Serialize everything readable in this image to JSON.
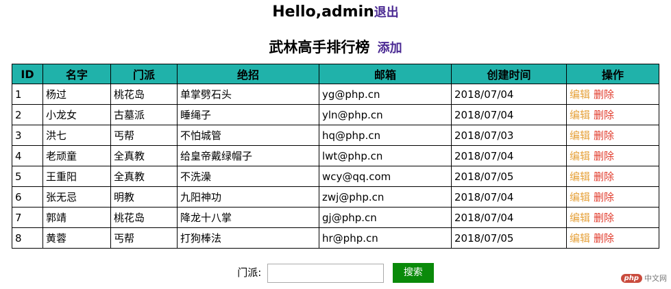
{
  "header": {
    "greeting": "Hello,admin",
    "logout": "退出"
  },
  "page": {
    "title": "武林高手排行榜",
    "add": "添加"
  },
  "table": {
    "columns": [
      "ID",
      "名字",
      "门派",
      "绝招",
      "邮箱",
      "创建时间",
      "操作"
    ],
    "rows": [
      {
        "id": "1",
        "name": "杨过",
        "sect": "桃花岛",
        "skill": "单掌劈石头",
        "email": "yg@php.cn",
        "created": "2018/07/04",
        "edit": "编辑",
        "delete": "删除"
      },
      {
        "id": "2",
        "name": "小龙女",
        "sect": "古墓派",
        "skill": "睡绳子",
        "email": "yln@php.cn",
        "created": "2018/07/04",
        "edit": "编辑",
        "delete": "删除"
      },
      {
        "id": "3",
        "name": "洪七",
        "sect": "丐帮",
        "skill": "不怕城管",
        "email": "hq@php.cn",
        "created": "2018/07/03",
        "edit": "编辑",
        "delete": "删除"
      },
      {
        "id": "4",
        "name": "老顽童",
        "sect": "全真教",
        "skill": "给皇帝戴绿帽子",
        "email": "lwt@php.cn",
        "created": "2018/07/04",
        "edit": "编辑",
        "delete": "删除"
      },
      {
        "id": "5",
        "name": "王重阳",
        "sect": "全真教",
        "skill": "不洗澡",
        "email": "wcy@qq.com",
        "created": "2018/07/05",
        "edit": "编辑",
        "delete": "删除"
      },
      {
        "id": "6",
        "name": "张无忌",
        "sect": "明教",
        "skill": "九阳神功",
        "email": "zwj@php.cn",
        "created": "2018/07/04",
        "edit": "编辑",
        "delete": "删除"
      },
      {
        "id": "7",
        "name": "郭靖",
        "sect": "桃花岛",
        "skill": "降龙十八掌",
        "email": "gj@php.cn",
        "created": "2018/07/04",
        "edit": "编辑",
        "delete": "删除"
      },
      {
        "id": "8",
        "name": "黄蓉",
        "sect": "丐帮",
        "skill": "打狗棒法",
        "email": "hr@php.cn",
        "created": "2018/07/05",
        "edit": "编辑",
        "delete": "删除"
      }
    ]
  },
  "search": {
    "label": "门派:",
    "value": "",
    "button": "搜索"
  },
  "watermark": {
    "logo": "php",
    "text": "中文网"
  },
  "colors": {
    "header_bg": "#20b2aa",
    "link": "#4b2a93",
    "edit": "#e6a23c",
    "delete": "#e03a2b",
    "search_button": "#0a8a0a"
  }
}
